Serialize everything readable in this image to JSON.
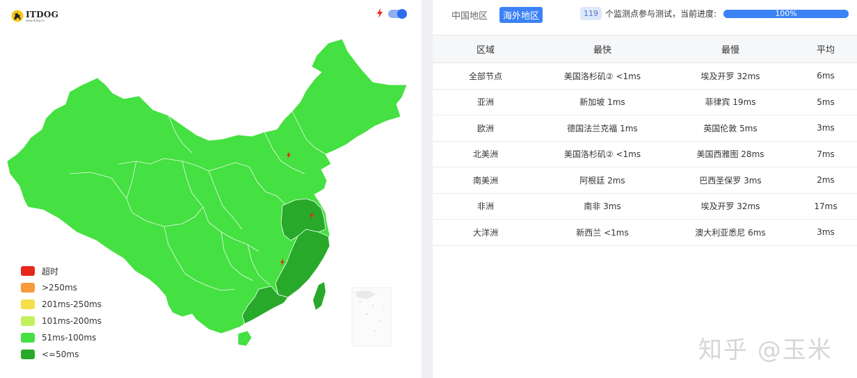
{
  "logo": {
    "brand": "ITDOG",
    "url": "www.itdog.cn"
  },
  "colors": {
    "timeout": "#e8261b",
    "over250": "#f79a3a",
    "r201_250": "#f3e04a",
    "r101_200": "#c2f05c",
    "r51_100": "#45e041",
    "le50": "#28a92a",
    "accent": "#3b82f6"
  },
  "legend": [
    {
      "label": "超时",
      "color": "#e8261b"
    },
    {
      "label": ">250ms",
      "color": "#f79a3a"
    },
    {
      "label": "201ms-250ms",
      "color": "#f3e04a"
    },
    {
      "label": "101ms-200ms",
      "color": "#c2f05c"
    },
    {
      "label": "51ms-100ms",
      "color": "#45e041"
    },
    {
      "label": "<=50ms",
      "color": "#28a92a"
    }
  ],
  "tabs": {
    "china": "中国地区",
    "overseas": "海外地区"
  },
  "progress": {
    "count": "119",
    "text": "个监测点参与测试，当前进度:",
    "percent_label": "100%",
    "value": 1.0
  },
  "table": {
    "headers": {
      "region": "区域",
      "fastest": "最快",
      "slowest": "最慢",
      "average": "平均"
    },
    "rows": [
      {
        "region": "全部节点",
        "fastest": "美国洛杉矶② <1ms",
        "slowest": "埃及开罗 32ms",
        "average": "6ms"
      },
      {
        "region": "亚洲",
        "fastest": "新加坡 1ms",
        "slowest": "菲律宾 19ms",
        "average": "5ms"
      },
      {
        "region": "欧洲",
        "fastest": "德国法兰克福 1ms",
        "slowest": "英国伦敦 5ms",
        "average": "3ms"
      },
      {
        "region": "北美洲",
        "fastest": "美国洛杉矶② <1ms",
        "slowest": "美国西雅图 28ms",
        "average": "7ms"
      },
      {
        "region": "南美洲",
        "fastest": "阿根廷 2ms",
        "slowest": "巴西圣保罗 3ms",
        "average": "2ms"
      },
      {
        "region": "非洲",
        "fastest": "南非 3ms",
        "slowest": "埃及开罗 32ms",
        "average": "17ms"
      },
      {
        "region": "大洋洲",
        "fastest": "新西兰 <1ms",
        "slowest": "澳大利亚悉尼 6ms",
        "average": "3ms"
      }
    ]
  },
  "watermark": "知乎 @玉米"
}
